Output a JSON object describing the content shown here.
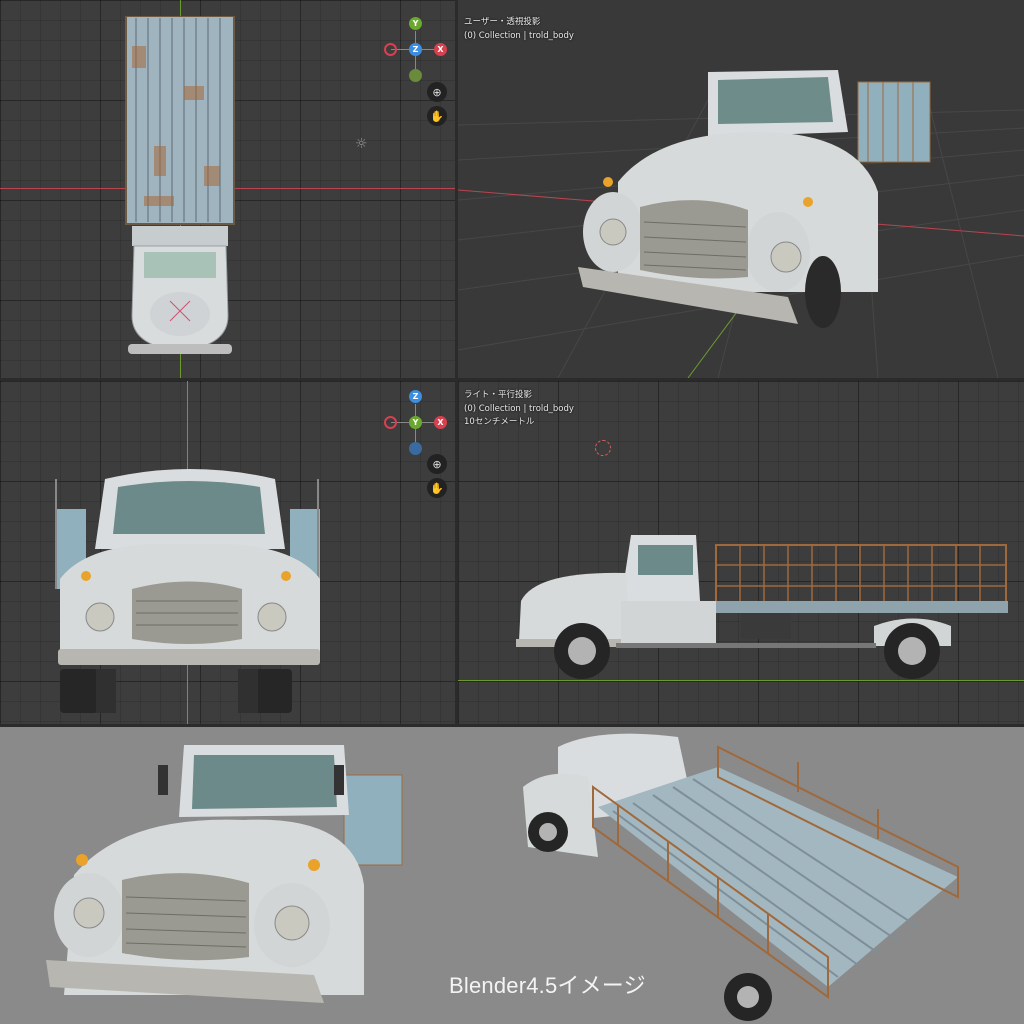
{
  "viewport_top": {
    "gizmo": {
      "y": "Y",
      "z": "Z",
      "x": "X"
    },
    "nav": {
      "zoom_icon": "zoom-icon",
      "pan_icon": "hand-icon"
    },
    "colors": {
      "x": "#d7404f",
      "y": "#6aa82e",
      "z": "#3d8ee0"
    }
  },
  "viewport_user": {
    "view_name": "ユーザー・透視投影",
    "collection": "(0) Collection | trold_body"
  },
  "viewport_front": {
    "gizmo": {
      "z": "Z",
      "y": "Y",
      "x": "X"
    },
    "nav": {
      "zoom_icon": "zoom-icon",
      "pan_icon": "hand-icon"
    }
  },
  "viewport_right": {
    "view_name": "ライト・平行投影",
    "collection": "(0) Collection | trold_body",
    "scale": "10センチメートル"
  },
  "render": {
    "caption": "Blender4.5イメージ"
  }
}
